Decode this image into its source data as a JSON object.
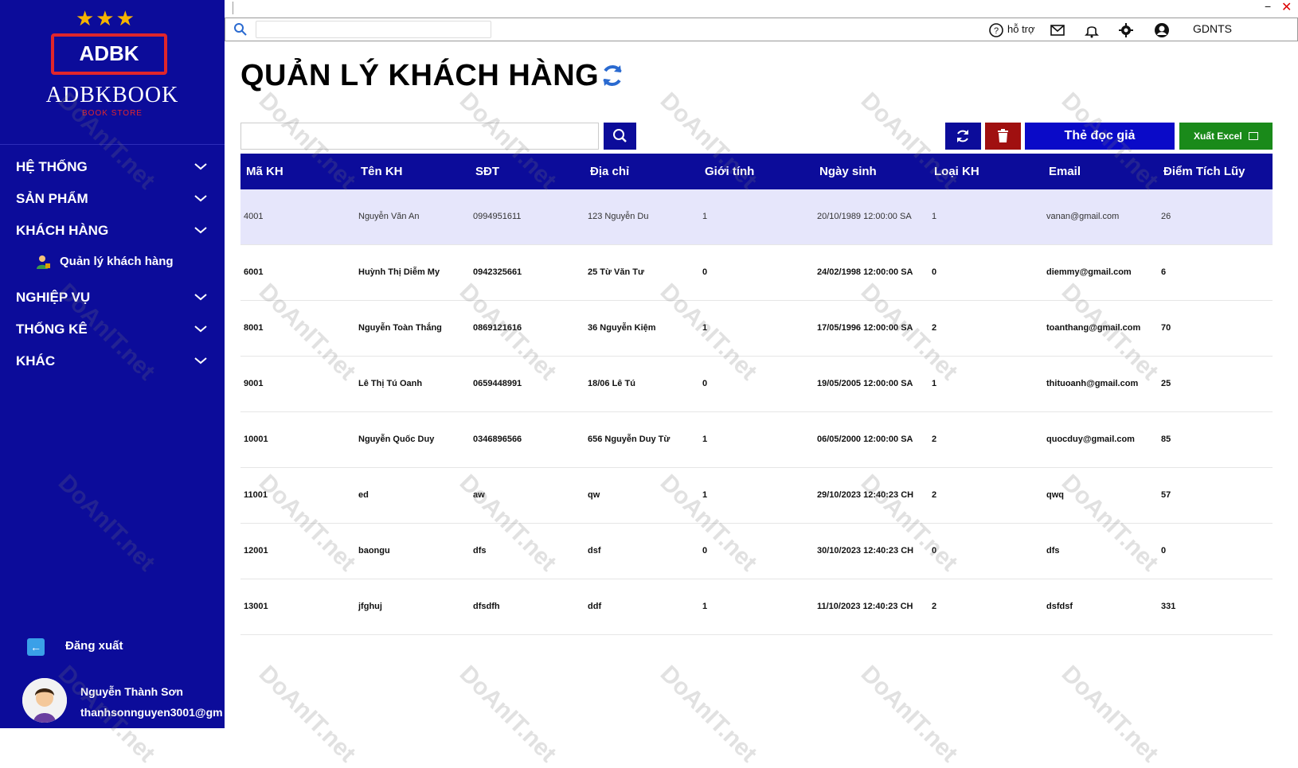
{
  "window": {
    "minimize": "−",
    "close": "✕"
  },
  "brand": {
    "badge": "ADBK",
    "name": "ADBKBOOK",
    "store": "BOOK STORE",
    "stars": "★★★"
  },
  "sidebar": {
    "items": [
      {
        "label": "HỆ THỐNG"
      },
      {
        "label": "SẢN PHẨM"
      },
      {
        "label": "KHÁCH HÀNG"
      },
      {
        "label": "NGHIỆP VỤ"
      },
      {
        "label": "THỐNG KÊ"
      },
      {
        "label": "KHÁC"
      }
    ],
    "sub_item": {
      "label": "Quản lý khách hàng"
    },
    "logout": {
      "label": "Đăng xuất"
    },
    "user": {
      "name": "Nguyễn Thành Sơn",
      "email": "thanhsonnguyen3001@gm"
    }
  },
  "topbar": {
    "search_placeholder": "",
    "help_label": "hỗ trợ",
    "account_label": "GDNTS"
  },
  "main": {
    "title": "QUẢN LÝ KHÁCH HÀNG",
    "search_placeholder": "",
    "reader_card_label": "Thẻ đọc giả",
    "export_excel_label": "Xuất Excel"
  },
  "colors": {
    "sidebar": "#0c0c9a",
    "header": "#0c0c9a",
    "delete": "#a01010",
    "card": "#0a0ac8",
    "excel": "#1a8a1a",
    "selected_row": "#e6e6fb"
  },
  "table": {
    "columns": [
      "Mã KH",
      "Tên KH",
      "SĐT",
      "Địa chỉ",
      "Giới tính",
      "Ngày sinh",
      "Loại KH",
      "Email",
      "Điểm Tích Lũy"
    ],
    "rows": [
      [
        "4001",
        "Nguyễn Văn An",
        "0994951611",
        "123 Nguyễn Du",
        "1",
        "20/10/1989 12:00:00 SA",
        "1",
        "vanan@gmail.com",
        "26"
      ],
      [
        "6001",
        "Huỳnh Thị Diễm My",
        "0942325661",
        "25 Từ Văn Tư",
        "0",
        "24/02/1998 12:00:00 SA",
        "0",
        "diemmy@gmail.com",
        "6"
      ],
      [
        "8001",
        "Nguyễn Toàn Thắng",
        "0869121616",
        "36 Nguyễn Kiệm",
        "1",
        "17/05/1996 12:00:00 SA",
        "2",
        "toanthang@gmail.com",
        "70"
      ],
      [
        "9001",
        "Lê Thị Tú Oanh",
        "0659448991",
        "18/06 Lê Tú",
        "0",
        "19/05/2005 12:00:00 SA",
        "1",
        "thituoanh@gmail.com",
        "25"
      ],
      [
        "10001",
        "Nguyễn Quốc Duy",
        "0346896566",
        "656 Nguyễn Duy Từ",
        "1",
        "06/05/2000 12:00:00 SA",
        "2",
        "quocduy@gmail.com",
        "85"
      ],
      [
        "11001",
        "ed",
        "aw",
        "qw",
        "1",
        "29/10/2023 12:40:23 CH",
        "2",
        "qwq",
        "57"
      ],
      [
        "12001",
        "baongu",
        "dfs",
        "dsf",
        "0",
        "30/10/2023 12:40:23 CH",
        "0",
        "dfs",
        "0"
      ],
      [
        "13001",
        "jfghuj",
        "dfsdfh",
        "ddf",
        "1",
        "11/10/2023 12:40:23 CH",
        "2",
        "dsfdsf",
        "331"
      ]
    ]
  },
  "watermark": {
    "text": "DoAnIT.net"
  }
}
